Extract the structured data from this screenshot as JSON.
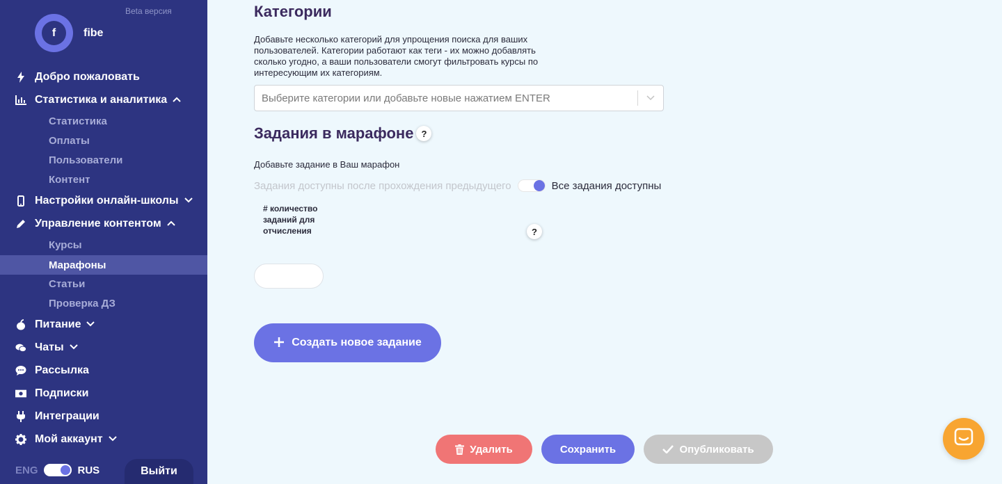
{
  "sidebar": {
    "beta_label": "Beta версия",
    "avatar_letter": "f",
    "school_name": "fibe",
    "items": [
      {
        "label": "Добро пожаловать",
        "icon": "bolt-icon"
      },
      {
        "label": "Статистика и аналитика",
        "icon": "chart-icon",
        "expanded": true
      },
      {
        "label": "Настройки онлайн-школы",
        "icon": "phone-icon",
        "expanded": false
      },
      {
        "label": "Управление контентом",
        "icon": "pencil-icon",
        "expanded": true
      },
      {
        "label": "Питание",
        "icon": "apple-icon",
        "expanded": false
      },
      {
        "label": "Чаты",
        "icon": "chat-icon",
        "expanded": false
      },
      {
        "label": "Рассылка",
        "icon": "message-icon"
      },
      {
        "label": "Подписки",
        "icon": "money-icon"
      },
      {
        "label": "Интеграции",
        "icon": "plug-icon"
      },
      {
        "label": "Мой аккаунт",
        "icon": "gear-icon",
        "expanded": false
      }
    ],
    "stats_sub": [
      "Статистика",
      "Оплаты",
      "Пользователи",
      "Контент"
    ],
    "content_sub": [
      "Курсы",
      "Марафоны",
      "Статьи",
      "Проверка ДЗ"
    ],
    "active_sub": "Марафоны",
    "lang_eng": "ENG",
    "lang_rus": "RUS",
    "logout": "Выйти"
  },
  "main": {
    "categories_title": "Категории",
    "categories_desc": "Добавьте несколько категорий для упрощения поиска для ваших пользователей. Категории работают как теги - их можно добавлять сколько угодно, а ваши пользователи смогут фильтровать курсы по интересующим их категориям.",
    "categories_placeholder": "Выберите категории или добавьте новые нажатием ENTER",
    "tasks_title": "Задания в марафоне",
    "help_mark": "?",
    "tasks_desc": "Добавьте задание в Ваш марафон",
    "toggle_off_label": "Задания доступны после прохождения предыдущего",
    "toggle_on_label": "Все задания доступны",
    "dropout_label": "# количество заданий для отчисления",
    "dropout_value": "",
    "create_task": "Создать новое задание"
  },
  "footer": {
    "delete": "Удалить",
    "save": "Сохранить",
    "publish": "Опубликовать"
  },
  "colors": {
    "sidebar": "#2d3481",
    "accent": "#6b72e4",
    "danger": "#f07575",
    "disabled": "#c7c7c7",
    "chat": "#f8a531"
  }
}
